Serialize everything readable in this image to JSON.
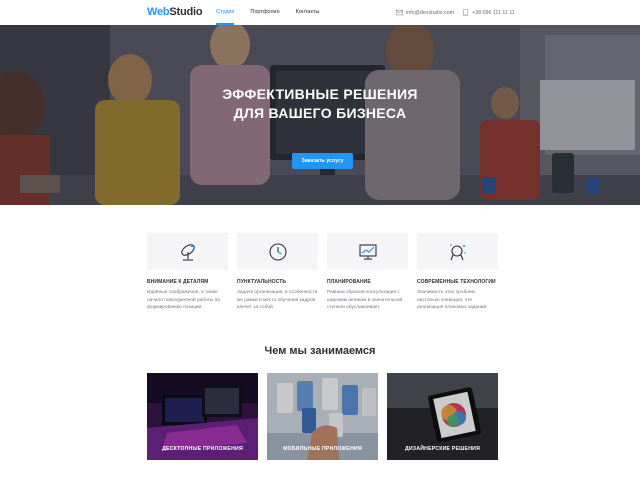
{
  "header": {
    "logo_accent": "Web",
    "logo_rest": "Studio",
    "nav": [
      "Студия",
      "Портфолио",
      "Контакты"
    ],
    "email": "info@devstudio.com",
    "phone": "+38 096 111 11 11"
  },
  "hero": {
    "title_line1": "ЭФФЕКТИВНЫЕ РЕШЕНИЯ",
    "title_line2": "ДЛЯ ВАШЕГО БИЗНЕСА",
    "button": "Заказать услугу"
  },
  "features": [
    {
      "title": "ВНИМАНИЕ К ДЕТАЛЯМ",
      "text": "Идейные соображения, а также начало повседневной работы по формированию позиции.",
      "icon": "telescope-icon"
    },
    {
      "title": "ПУНКТУАЛЬНОСТЬ",
      "text": "Задача организации, в особенности же рамки и место обучения кадров влечет за собой.",
      "icon": "clock-icon"
    },
    {
      "title": "ПЛАНИРОВАНИЕ",
      "text": "Равным образом консультация с широким активом в значительной степени обуславливает.",
      "icon": "chart-icon"
    },
    {
      "title": "СОВРЕМЕННЫЕ ТЕХНОЛОГИИ",
      "text": "Значимость этих проблем настолько очевидна, что реализация плановых заданий.",
      "icon": "astronaut-icon"
    }
  ],
  "section": {
    "title": "Чем мы занимаемся",
    "cards": [
      "ДЕСКТОПНЫЕ ПРИЛОЖЕНИЯ",
      "МОБИЛЬНЫЕ ПРИЛОЖЕНИЯ",
      "ДИЗАЙНЕРСКИЕ РЕШЕНИЯ"
    ]
  },
  "colors": {
    "accent": "#2196f3",
    "text": "#2f2f37",
    "feature_bg": "#f5f5f8"
  }
}
